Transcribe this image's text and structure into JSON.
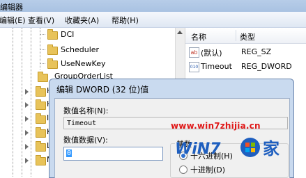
{
  "window": {
    "title": "编辑器"
  },
  "menu": [
    "编辑(E)",
    "查看(V)",
    "收藏夹(A)",
    "帮助(H)"
  ],
  "tree": {
    "items": [
      {
        "label": "DCI"
      },
      {
        "label": "Scheduler"
      },
      {
        "label": "UseNewKey"
      },
      {
        "label": "GroupOrderList"
      }
    ],
    "partial_rows": [
      "H",
      "H",
      "I",
      "K",
      "L",
      "M"
    ]
  },
  "values_pane": {
    "columns": [
      "名称",
      "类型"
    ],
    "rows": [
      {
        "icon": "ab",
        "name": "(默认)",
        "type": "REG_SZ"
      },
      {
        "icon": "010",
        "name": "Timeout",
        "type": "REG_DWORD"
      }
    ]
  },
  "dialog": {
    "title": "编辑 DWORD (32 位)值",
    "value_name_label": "数值名称(N):",
    "value_name": "Timeout",
    "value_data_label": "数值数据(V):",
    "value_data": "0",
    "base_label": "基数",
    "base_options": [
      {
        "label": "十六进制(H)",
        "selected": true
      },
      {
        "label": "十进制(D)",
        "selected": false
      }
    ]
  },
  "watermark": {
    "url": "www.win7zhijia.cn",
    "logo_text": "WiN7",
    "logo_suffix": "家"
  },
  "colors": {
    "accent": "#3399ff",
    "watermark": "#e01818",
    "logo_blue": "#1f5fbf"
  }
}
